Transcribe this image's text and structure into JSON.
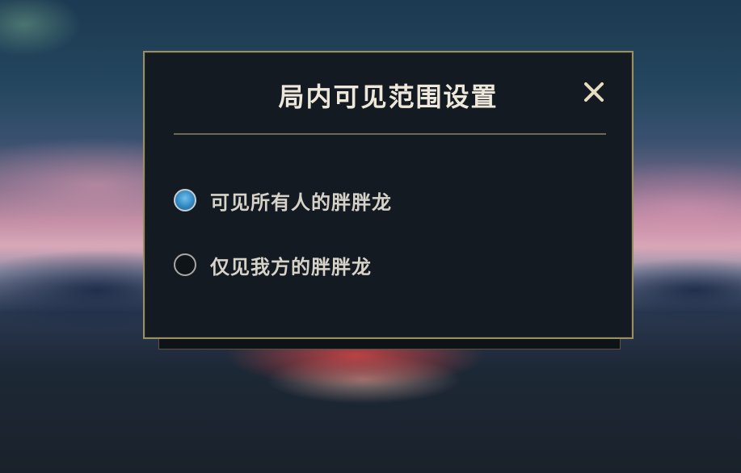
{
  "dialog": {
    "title": "局内可见范围设置",
    "close_icon": "close-x-icon",
    "options": [
      {
        "label": "可见所有人的胖胖龙",
        "selected": true
      },
      {
        "label": "仅见我方的胖胖龙",
        "selected": false
      }
    ]
  },
  "colors": {
    "dialog_background": "#131a21",
    "dialog_border": "#9a8e64",
    "title_text": "#eee8da",
    "option_text": "#d6d2c8",
    "radio_selected": "#3288c0",
    "close_icon": "#e6dcc0"
  }
}
